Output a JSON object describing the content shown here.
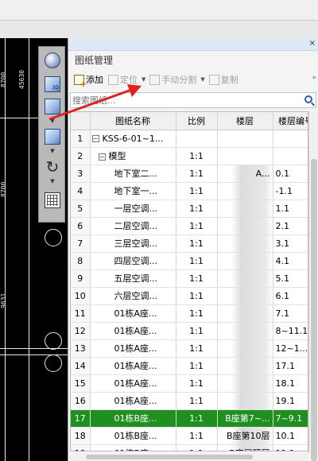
{
  "panel": {
    "title": "图纸管理",
    "close_glyph": "×"
  },
  "toolbar": {
    "add_label": "添加",
    "locate_label": "定位",
    "manual_split_label": "手动分割",
    "copy_label": "复制"
  },
  "search": {
    "placeholder": "搜索图纸..."
  },
  "table": {
    "headers": [
      "",
      "图纸名称",
      "比例",
      "楼层",
      "楼层编号"
    ],
    "rows": [
      {
        "num": "1",
        "name": "KSS-6-01~1...",
        "ratio": "",
        "floor": "",
        "floor_no": "",
        "tree": "minus"
      },
      {
        "num": "2",
        "name": "模型",
        "ratio": "1:1",
        "floor": "",
        "floor_no": "",
        "tree": "minus"
      },
      {
        "num": "3",
        "name": "地下室二...",
        "ratio": "1:1",
        "floor": "A...",
        "floor_no": "0.1"
      },
      {
        "num": "4",
        "name": "地下室一...",
        "ratio": "1:1",
        "floor": "",
        "floor_no": "-1.1"
      },
      {
        "num": "5",
        "name": "一层空调...",
        "ratio": "1:1",
        "floor": "",
        "floor_no": "1.1"
      },
      {
        "num": "6",
        "name": "二层空调...",
        "ratio": "1:1",
        "floor": "",
        "floor_no": "2.1"
      },
      {
        "num": "7",
        "name": "三层空调...",
        "ratio": "1:1",
        "floor": "",
        "floor_no": "3.1"
      },
      {
        "num": "8",
        "name": "四层空调...",
        "ratio": "1:1",
        "floor": "",
        "floor_no": "4.1"
      },
      {
        "num": "9",
        "name": "五层空调...",
        "ratio": "1:1",
        "floor": "",
        "floor_no": "5.1"
      },
      {
        "num": "10",
        "name": "六层空调...",
        "ratio": "1:1",
        "floor": "",
        "floor_no": "6.1"
      },
      {
        "num": "11",
        "name": "01栋A座...",
        "ratio": "1:1",
        "floor": "",
        "floor_no": "7.1"
      },
      {
        "num": "12",
        "name": "01栋A座...",
        "ratio": "1:1",
        "floor": "",
        "floor_no": "8~11.1"
      },
      {
        "num": "13",
        "name": "01栋A座...",
        "ratio": "1:1",
        "floor": "",
        "floor_no": "12~1..."
      },
      {
        "num": "14",
        "name": "01栋A座...",
        "ratio": "1:1",
        "floor": "",
        "floor_no": "17.1"
      },
      {
        "num": "15",
        "name": "01栋A座...",
        "ratio": "1:1",
        "floor": "",
        "floor_no": "18.1"
      },
      {
        "num": "16",
        "name": "01栋A座...",
        "ratio": "1:1",
        "floor": "",
        "floor_no": "19.1"
      },
      {
        "num": "17",
        "name": "01栋B座...",
        "ratio": "1:1",
        "floor": "B座第7~...",
        "floor_no": "7~9.1",
        "selected": true
      },
      {
        "num": "18",
        "name": "01栋B座...",
        "ratio": "1:1",
        "floor": "B座第10层",
        "floor_no": "10.1"
      },
      {
        "num": "19",
        "name": "01栋B座...",
        "ratio": "1:1",
        "floor": "B座屋顶层",
        "floor_no": "11.1"
      }
    ]
  },
  "canvas": {
    "dims": [
      "8700",
      "45630",
      "8700",
      "9631"
    ]
  },
  "colors": {
    "selected_row": "#1f8f1f",
    "annotation_arrow": "#e02020",
    "panel_bg": "#f4f4f4"
  }
}
